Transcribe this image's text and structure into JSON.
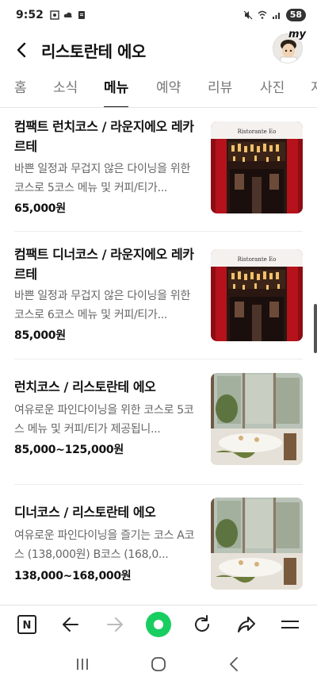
{
  "status": {
    "time": "9:52",
    "battery": "58"
  },
  "header": {
    "title": "리스토란테 에오",
    "my_label": "my"
  },
  "tabs": [
    {
      "label": "홈"
    },
    {
      "label": "소식"
    },
    {
      "label": "메뉴"
    },
    {
      "label": "예약"
    },
    {
      "label": "리뷰"
    },
    {
      "label": "사진"
    },
    {
      "label": "지"
    }
  ],
  "menu": [
    {
      "name": "컴팩트 런치코스 / 라운지에오 레카르테",
      "desc": "바쁜 일정과 무겁지 않은 다이닝을 위한 코스로 5코스 메뉴 및 커피/티가...",
      "price": "65,000원",
      "sign": "Ristorante Eo",
      "image": "lounge"
    },
    {
      "name": "컴팩트 디너코스 / 라운지에오 레카르테",
      "desc": "바쁜 일정과 무겁지 않은 다이닝을 위한 코스로 6코스 메뉴 및 커피/티가...",
      "price": "85,000원",
      "sign": "Ristorante Eo",
      "image": "lounge"
    },
    {
      "name": "런치코스 / 리스토란테 에오",
      "desc": "여유로운 파인다이닝을 위한 코스로 5코스 메뉴 및 커피/티가 제공됩니...",
      "price": "85,000~125,000원",
      "sign": "",
      "image": "dining"
    },
    {
      "name": "디너코스 / 리스토란테 에오",
      "desc": "여유로운 파인다이닝을 즐기는 코스 A코스 (138,000원) B코스 (168,0...",
      "price": "138,000~168,000원",
      "sign": "",
      "image": "dining"
    }
  ],
  "colors": {
    "accent_green": "#19ce60",
    "lounge_red": "#b5121b"
  },
  "browser_bar": {
    "home_icon": "N"
  }
}
